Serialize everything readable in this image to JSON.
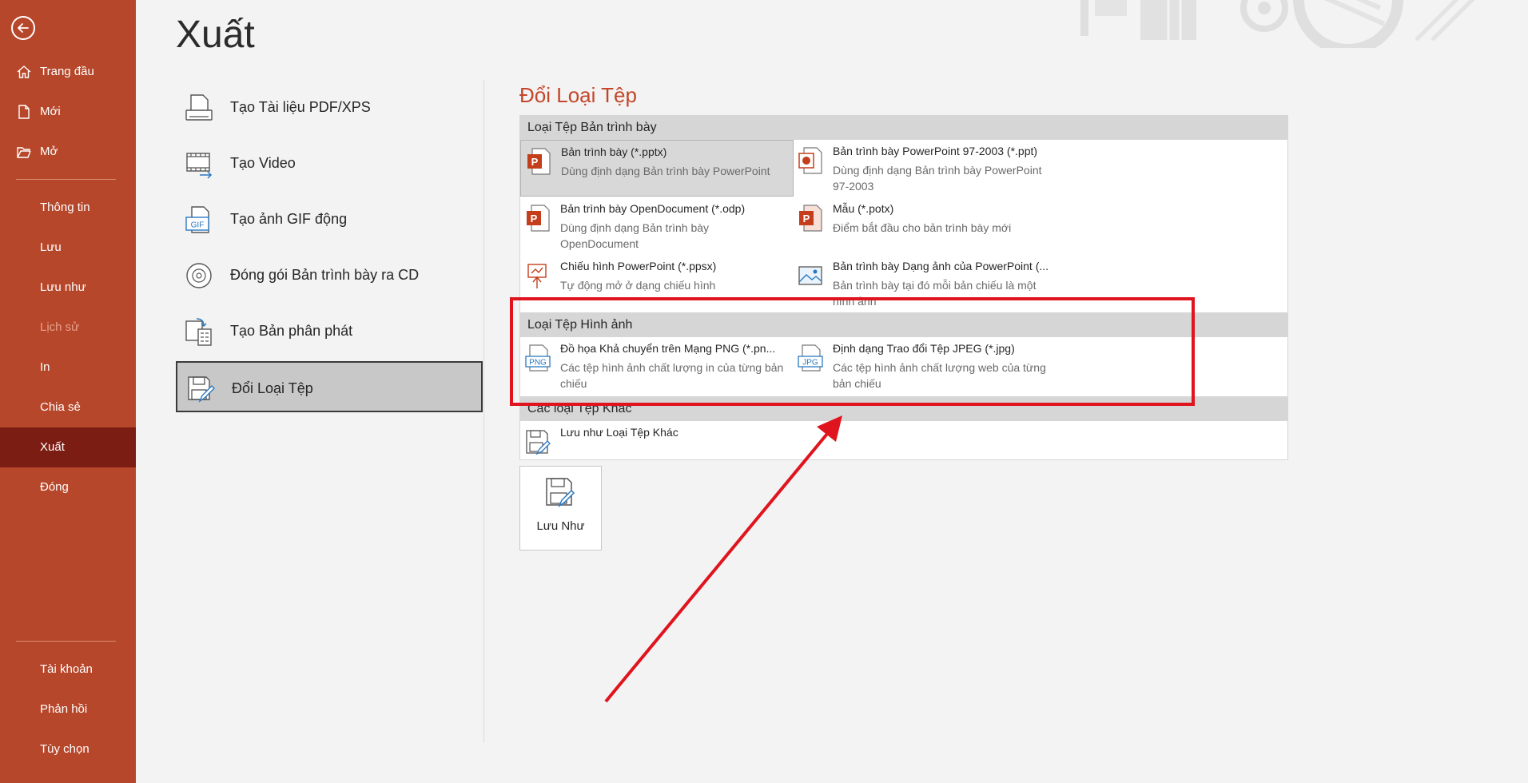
{
  "sidebar": {
    "items": [
      {
        "label": "Trang đầu",
        "icon": "home-icon",
        "state": "normal"
      },
      {
        "label": "Mới",
        "icon": "new-document-icon",
        "state": "normal"
      },
      {
        "label": "Mở",
        "icon": "open-folder-icon",
        "state": "normal"
      },
      {
        "label": "Thông tin",
        "state": "normal"
      },
      {
        "label": "Lưu",
        "state": "normal"
      },
      {
        "label": "Lưu như",
        "state": "normal"
      },
      {
        "label": "Lịch sử",
        "state": "disabled"
      },
      {
        "label": "In",
        "state": "normal"
      },
      {
        "label": "Chia sẻ",
        "state": "normal"
      },
      {
        "label": "Xuất",
        "state": "selected"
      },
      {
        "label": "Đóng",
        "state": "normal"
      },
      {
        "label": "Tài khoản",
        "state": "normal"
      },
      {
        "label": "Phản hồi",
        "state": "normal"
      },
      {
        "label": "Tùy chọn",
        "state": "normal"
      }
    ]
  },
  "page": {
    "title": "Xuất"
  },
  "export_options": [
    {
      "label": "Tạo Tài liệu PDF/XPS",
      "icon": "pdf-xps-icon"
    },
    {
      "label": "Tạo Video",
      "icon": "video-icon"
    },
    {
      "label": "Tạo ảnh GIF động",
      "icon": "gif-icon"
    },
    {
      "label": "Đóng gói Bản trình bày ra CD",
      "icon": "cd-icon"
    },
    {
      "label": "Tạo Bản phân phát",
      "icon": "handouts-icon"
    },
    {
      "label": "Đổi Loại Tệp",
      "icon": "change-file-type-icon"
    }
  ],
  "panel": {
    "title": "Đổi Loại Tệp",
    "groups": [
      {
        "header": "Loại Tệp Bản trình bày",
        "items": [
          {
            "title": "Bản trình bày (*.pptx)",
            "desc": "Dùng định dạng Bản trình bày PowerPoint",
            "icon": "pptx-icon"
          },
          {
            "title": "Bản trình bày PowerPoint 97-2003 (*.ppt)",
            "desc": "Dùng định dạng Bản trình bày PowerPoint 97-2003",
            "icon": "ppt-icon"
          },
          {
            "title": "Bản trình bày OpenDocument (*.odp)",
            "desc": "Dùng định dạng Bản trình bày OpenDocument",
            "icon": "odp-icon"
          },
          {
            "title": "Mẫu (*.potx)",
            "desc": "Điểm bắt đầu cho bản trình bày mới",
            "icon": "potx-icon"
          },
          {
            "title": "Chiếu hình PowerPoint (*.ppsx)",
            "desc": "Tự động mở ở dạng chiếu hình",
            "icon": "ppsx-icon"
          },
          {
            "title": "Bản trình bày Dạng ảnh của PowerPoint (...",
            "desc": "Bản trình bày tại đó mỗi bản chiếu là một hình ảnh",
            "icon": "picture-presentation-icon"
          }
        ]
      },
      {
        "header": "Loại Tệp Hình ảnh",
        "items": [
          {
            "title": "Đồ họa Khả chuyển trên Mạng PNG (*.pn...",
            "desc": "Các tệp hình ảnh chất lượng in của từng bản chiếu",
            "icon": "png-icon",
            "badge": "PNG"
          },
          {
            "title": "Định dạng Trao đổi Tệp JPEG (*.jpg)",
            "desc": "Các tệp hình ảnh chất lượng web của từng bản chiếu",
            "icon": "jpg-icon",
            "badge": "JPG"
          }
        ]
      },
      {
        "header": "Các loại Tệp Khác",
        "items": [
          {
            "title": "Lưu như Loại Tệp Khác",
            "desc": "",
            "icon": "other-file-type-icon"
          }
        ]
      }
    ],
    "save_as_button": "Lưu Như"
  },
  "gif_badge": "GIF",
  "colors": {
    "sidebar_bg": "#b7472a",
    "sidebar_selected": "#7c1d14",
    "accent_title": "#c4472a",
    "annotation": "#e0141e"
  }
}
